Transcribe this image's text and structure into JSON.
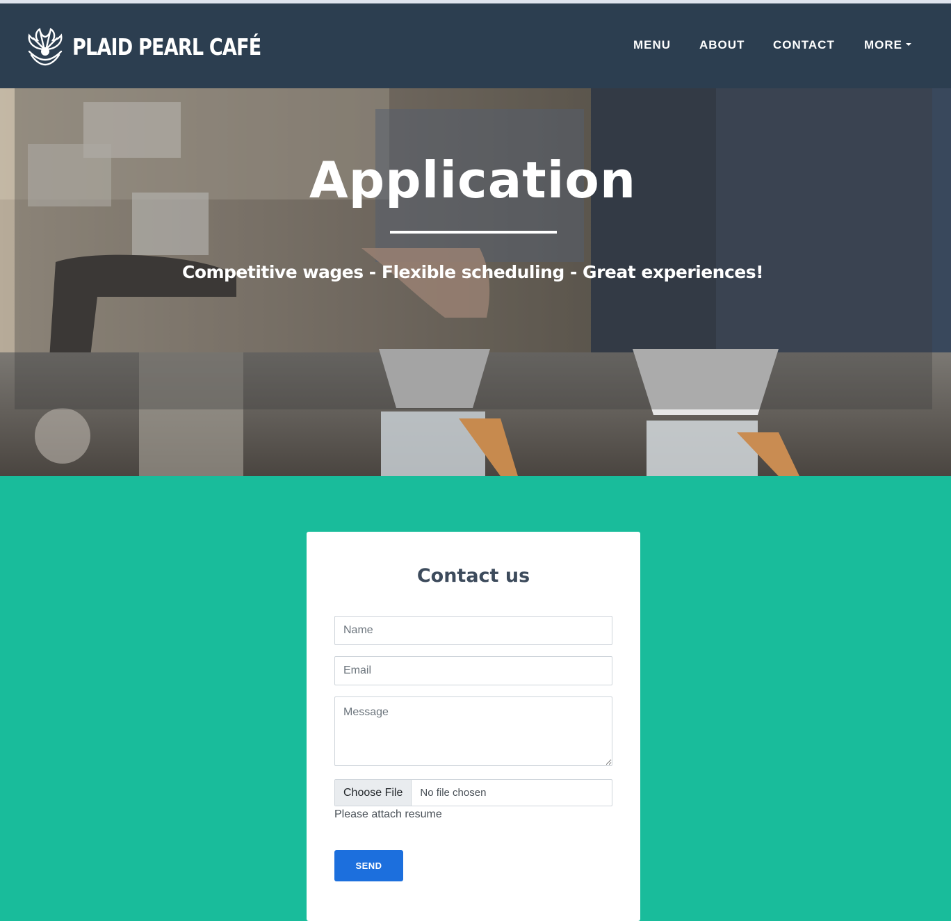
{
  "colors": {
    "nav_bg": "#2c3e50",
    "page_bg": "#19bc9b",
    "card_bg": "#ffffff",
    "send_button": "#1c6fdd",
    "heading_text": "#3d4b5c"
  },
  "nav": {
    "brand": "PLAID PEARL CAFÉ",
    "brand_icon": "pearl-shell-icon",
    "links": {
      "menu": "MENU",
      "about": "ABOUT",
      "contact": "CONTACT",
      "more": "MORE"
    }
  },
  "hero": {
    "title": "Application",
    "subtitle": "Competitive wages - Flexible scheduling - Great experiences!"
  },
  "form": {
    "title": "Contact us",
    "name_placeholder": "Name",
    "email_placeholder": "Email",
    "message_placeholder": "Message",
    "file_button": "Choose File",
    "file_status": "No file chosen",
    "file_help": "Please attach resume",
    "send_label": "SEND"
  }
}
